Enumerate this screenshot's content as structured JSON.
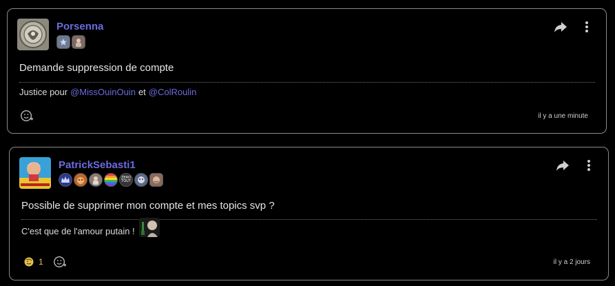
{
  "posts": [
    {
      "author": "Porsenna",
      "badges": [
        "star-badge",
        "portrait-badge"
      ],
      "title": "Demande suppression de compte",
      "body": {
        "prefix": "Justice pour",
        "mention1": "@MissOuinOuin",
        "connector": "et",
        "mention2": "@ColRoulin"
      },
      "timestamp": "il y a une minute"
    },
    {
      "author": "PatrickSebasti1",
      "badges": [
        "crown-badge",
        "cat-badge",
        "portrait-badge",
        "rainbow-badge",
        "zero-badge",
        "face-badge",
        "hex-badge"
      ],
      "zero_badge_text": "ZERO\nTOUT",
      "title": "Possible de supprimer mon compte et mes topics svp ?",
      "body": {
        "text": "C'est que de l'amour putain !"
      },
      "reaction_count": "1",
      "timestamp": "il y a 2 jours"
    }
  ],
  "colors": {
    "accent": "#6b6be0",
    "border": "#8a8a8a",
    "background": "#000000",
    "reaction": "#e0c04a"
  }
}
